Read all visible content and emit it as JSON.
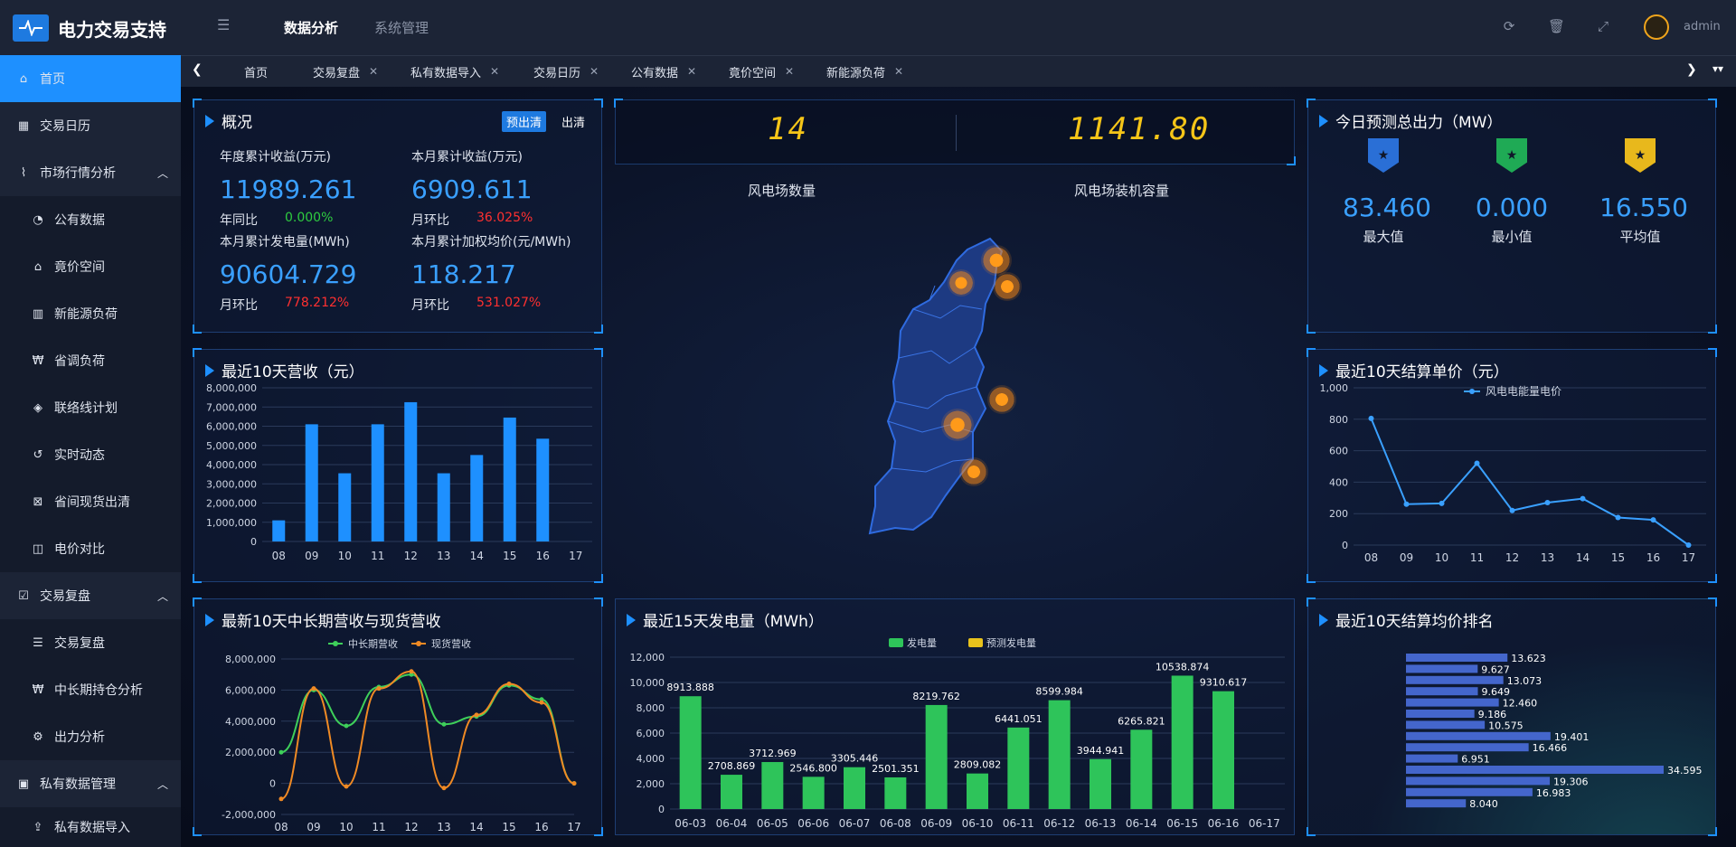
{
  "app": {
    "title": "电力交易支持",
    "user": "admin"
  },
  "topnav": {
    "analysis": "数据分析",
    "system": "系统管理"
  },
  "sidebar": {
    "items": [
      {
        "label": "首页",
        "icon": "home-icon"
      },
      {
        "label": "交易日历",
        "icon": "calendar-icon"
      },
      {
        "label": "市场行情分析",
        "icon": "line-chart-icon"
      },
      {
        "label": "公有数据",
        "icon": "dashboard-icon"
      },
      {
        "label": "竟价空间",
        "icon": "bank-icon"
      },
      {
        "label": "新能源负荷",
        "icon": "bar-chart-icon"
      },
      {
        "label": "省调负荷",
        "icon": "won-icon"
      },
      {
        "label": "联络线计划",
        "icon": "cube-icon"
      },
      {
        "label": "实时动态",
        "icon": "history-icon"
      },
      {
        "label": "省间现货出清",
        "icon": "grid-icon"
      },
      {
        "label": "电价对比",
        "icon": "columns-icon"
      },
      {
        "label": "交易复盘",
        "icon": "calendar-check-icon"
      },
      {
        "label": "交易复盘",
        "icon": "list-icon"
      },
      {
        "label": "中长期持仓分析",
        "icon": "won-icon"
      },
      {
        "label": "出力分析",
        "icon": "gear-icon"
      },
      {
        "label": "私有数据管理",
        "icon": "save-icon"
      },
      {
        "label": "私有数据导入",
        "icon": "upload-icon"
      }
    ]
  },
  "tabs": [
    "首页",
    "交易复盘",
    "私有数据导入",
    "交易日历",
    "公有数据",
    "竟价空间",
    "新能源负荷"
  ],
  "overview": {
    "title": "概况",
    "btn_pre": "预出清",
    "btn_clear": "出清",
    "annual_label": "年度累计收益(万元)",
    "annual_value": "11989.261",
    "annual_cmp_label": "年同比",
    "annual_cmp": "0.000%",
    "month_label": "本月累计收益(万元)",
    "month_value": "6909.611",
    "month_cmp_label": "月环比",
    "month_cmp": "36.025%",
    "gen_label": "本月累计发电量(MWh)",
    "gen_value": "90604.729",
    "gen_cmp_label": "月环比",
    "gen_cmp": "778.212%",
    "price_label": "本月累计加权均价(元/MWh)",
    "price_value": "118.217",
    "price_cmp_label": "月环比",
    "price_cmp": "531.027%"
  },
  "center": {
    "farm_count": "14",
    "farm_count_label": "风电场数量",
    "capacity": "1141.80",
    "capacity_label": "风电场装机容量"
  },
  "forecast": {
    "title": "今日预测总出力（MW）",
    "max": "83.460",
    "max_label": "最大值",
    "min": "0.000",
    "min_label": "最小值",
    "avg": "16.550",
    "avg_label": "平均值",
    "colors": [
      "#2a6fd6",
      "#1faa55",
      "#e8b81c"
    ]
  },
  "revenue10": {
    "title": "最近10天营收（元）",
    "chart_data": {
      "type": "bar",
      "categories": [
        "08",
        "09",
        "10",
        "11",
        "12",
        "13",
        "14",
        "15",
        "16",
        "17"
      ],
      "values": [
        1100000,
        6100000,
        3550000,
        6100000,
        7250000,
        3550000,
        4500000,
        6450000,
        5350000,
        0
      ],
      "ylim": [
        0,
        8000000
      ],
      "yticks": [
        "0",
        "1,000,000",
        "2,000,000",
        "3,000,000",
        "4,000,000",
        "5,000,000",
        "6,000,000",
        "7,000,000",
        "8,000,000"
      ],
      "color": "#1e90ff"
    }
  },
  "price10": {
    "title": "最近10天结算单价（元）",
    "chart_data": {
      "type": "line",
      "categories": [
        "08",
        "09",
        "10",
        "11",
        "12",
        "13",
        "14",
        "15",
        "16",
        "17"
      ],
      "series": [
        {
          "name": "风电电能量电价",
          "values": [
            805,
            260,
            265,
            520,
            220,
            270,
            295,
            175,
            160,
            0
          ]
        }
      ],
      "ylim": [
        0,
        1000
      ],
      "yticks": [
        "0",
        "200",
        "400",
        "600",
        "800",
        "1,000"
      ],
      "color": "#3aa0ff"
    }
  },
  "longspot": {
    "title": "最新10天中长期营收与现货营收",
    "chart_data": {
      "type": "line",
      "categories": [
        "08",
        "09",
        "10",
        "11",
        "12",
        "13",
        "14",
        "15",
        "16",
        "17"
      ],
      "series": [
        {
          "name": "中长期营收",
          "values": [
            2000000,
            6000000,
            3700000,
            6200000,
            7000000,
            3800000,
            4300000,
            6300000,
            5400000,
            0
          ],
          "color": "#3ecf5a"
        },
        {
          "name": "现货营收",
          "values": [
            -1000000,
            6100000,
            -200000,
            6100000,
            7200000,
            -300000,
            4400000,
            6400000,
            5200000,
            0
          ],
          "color": "#f08a24"
        }
      ],
      "ylim": [
        -2000000,
        8000000
      ],
      "yticks": [
        "-2,000,000",
        "0",
        "2,000,000",
        "4,000,000",
        "6,000,000",
        "8,000,000"
      ]
    }
  },
  "gen15": {
    "title": "最近15天发电量（MWh）",
    "chart_data": {
      "type": "bar",
      "categories": [
        "06-03",
        "06-04",
        "06-05",
        "06-06",
        "06-07",
        "06-08",
        "06-09",
        "06-10",
        "06-11",
        "06-12",
        "06-13",
        "06-14",
        "06-15",
        "06-16",
        "06-17"
      ],
      "series": [
        {
          "name": "发电量",
          "values": [
            8913.888,
            2708.869,
            3712.969,
            2546.8,
            3305.446,
            2501.351,
            8219.762,
            2809.082,
            6441.051,
            8599.984,
            3944.941,
            6265.821,
            10538.874,
            9310.617,
            0
          ],
          "color": "#2ec45a"
        },
        {
          "name": "预测发电量",
          "values": [],
          "color": "#e8c21c"
        }
      ],
      "labels": [
        "8913.888",
        "2708.869",
        "3712.969",
        "2546.800",
        "3305.446",
        "2501.351",
        "8219.762",
        "2809.082",
        "6441.051",
        "8599.984",
        "3944.941",
        "6265.821",
        "10538.874",
        "9310.617",
        ""
      ],
      "ylim": [
        0,
        12000
      ],
      "yticks": [
        "0",
        "2,000",
        "4,000",
        "6,000",
        "8,000",
        "10,000",
        "12,000"
      ]
    }
  },
  "rank10": {
    "title": "最近10天结算均价排名",
    "chart_data": {
      "type": "bar",
      "values": [
        13.623,
        9.627,
        13.073,
        9.649,
        12.46,
        9.186,
        10.575,
        19.401,
        16.466,
        6.951,
        34.595,
        19.306,
        16.983,
        8.04
      ],
      "labels": [
        "13.623",
        "9.627",
        "13.073",
        "9.649",
        "12.460",
        "9.186",
        "10.575",
        "19.401",
        "16.466",
        "6.951",
        "34.595",
        "19.306",
        "16.983",
        "8.040"
      ],
      "color": "#4466cc"
    }
  }
}
